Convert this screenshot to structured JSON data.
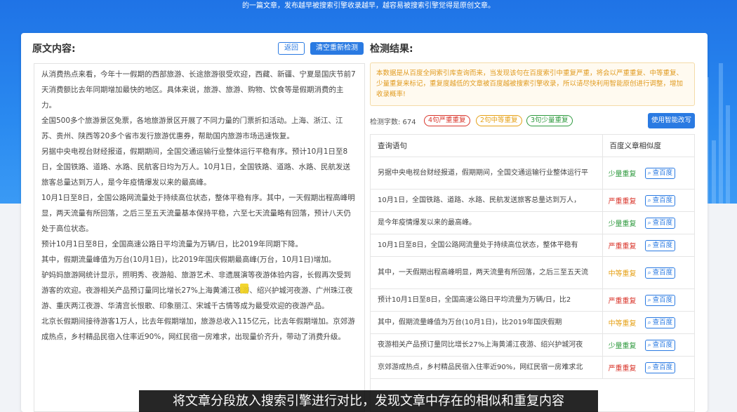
{
  "banner": {
    "text": "的一篇文章，发布越早被搜索引擎收录越早，越容易被搜索引擎觉得是原创文章。"
  },
  "left": {
    "title": "原文内容:",
    "back_label": "返回",
    "clear_label": "清空重新检测",
    "paragraphs": [
      "从消费热点来看，今年十一假期的西部旅游、长途旅游很受欢迎，西藏、新疆、宁夏是国庆节前7天消费额比去年同期增加最快的地区。具体来说，旅游、旅游、购物、饮食等是假期消费的主力。",
      "全国500多个旅游景区免票，各地旅游景区开展了不同力量的门票折扣活动。上海、浙江、江苏、贵州、陕西等20多个省市发行旅游优惠券，帮助国内旅游市场迅速恢复。",
      "另据中央电视台财经报道，假期期间，全国交通运输行业整体运行平稳有序。预计10月1日至8日，全国铁路、道路、水路、民航客日均为万人。10月1日，全国铁路、道路、水路、民航发送旅客总量达到万人，是今年疫情爆发以来的最高峰。",
      "10月1日至8日，全国公路网流量处于持续高位状态，整体平稳有序。其中，一天假期出程高峰明显，两天流量有所回落，之后三至五天流量基本保持平稳，六至七天流量略有回落，预计八天仍处于高位状态。",
      "预计10月1日至8日，全国高速公路日平均流量为万辆/日，比2019年同期下降。",
      "其中，假期流量峰值为万台(10月1日)，比2019年国庆假期最高峰(万台，10月1日)增加。",
      "驴妈妈旅游网统计显示，照明秀、夜游船、旅游艺术、非遗展演等夜游体验内容，长假再次受到游客的欢迎。夜游相关产品预订量同比增长27%上海黄浦江夜游、绍兴护城河夜游、广州珠江夜游、重庆两江夜游、华清宫长恨歌、印象丽江、宋城千古情等成为最受欢迎的夜游产品。",
      "北京长假期间接待游客1万人，比去年假期增加，旅游总收入115亿元，比去年假期增加。京郊游成热点，乡村精品民宿入住率近90%，网红民宿一房难求，出现量价齐升，带动了消费升级。"
    ]
  },
  "right": {
    "title": "检测结果:",
    "notice": "本数据是从百度全网索引库查询而来，当发现该句在百度索引中重复严重，将会以严重重复、中等重复、少量重复来标记，重复度越低的文章被百度越被搜索引擎收录，所以请尽快利用智能原创进行调整，增加收录概率!",
    "stats": {
      "count_label": "检测字数: 674",
      "severe_label": "4句严重重复",
      "medium_label": "2句中等重复",
      "minor_label": "3句少量重复",
      "rewrite_label": "使用智能改写"
    },
    "table": {
      "col_query": "查询语句",
      "col_similarity": "百度义章相似度",
      "check_label": "查百度",
      "rows": [
        {
          "query": "另据中央电视台财经报道，假期期间，全国交通运输行业整体运行平",
          "level": "少量重复",
          "tone": "minor",
          "tall": true
        },
        {
          "query": "10月1日，全国铁路、道路、水路、民航发送旅客总量达到万人，",
          "level": "严重重复",
          "tone": "severe",
          "tall": false
        },
        {
          "query": "是今年疫情爆发以来的最高峰。",
          "level": "少量重复",
          "tone": "minor",
          "tall": false
        },
        {
          "query": "10月1日至8日，全国公路网流量处于持续高位状态，整体平稳有",
          "level": "严重重复",
          "tone": "severe",
          "tall": false
        },
        {
          "query": "其中，一天假期出程高峰明显，两天流量有所回落，之后三至五天流",
          "level": "中等重复",
          "tone": "medium",
          "tall": true
        },
        {
          "query": "预计10月1日至8日，全国高速公路日平均流量为万辆/日，比2",
          "level": "严重重复",
          "tone": "severe",
          "tall": false
        },
        {
          "query": "其中，假期流量峰值为万台(10月1日)，比2019年国庆假期",
          "level": "中等重复",
          "tone": "medium",
          "tall": false
        },
        {
          "query": "夜游相关产品预订量同比增长27%上海黄浦江夜游、绍兴护城河夜",
          "level": "少量重复",
          "tone": "minor",
          "tall": false
        },
        {
          "query": "京郊游成热点，乡村精品民宿入住率近90%，网红民宿一房难求北",
          "level": "严重重复",
          "tone": "severe",
          "tall": false
        }
      ]
    }
  },
  "subtitle": "将文章分段放入搜索引擎进行对比，发现文章中存在的相似和重复内容",
  "colors": {
    "accent": "#2a7ae2",
    "severe": "#d9352b",
    "medium": "#e6a117",
    "minor": "#2f9a3f"
  },
  "icons": {
    "check": "search-icon"
  }
}
